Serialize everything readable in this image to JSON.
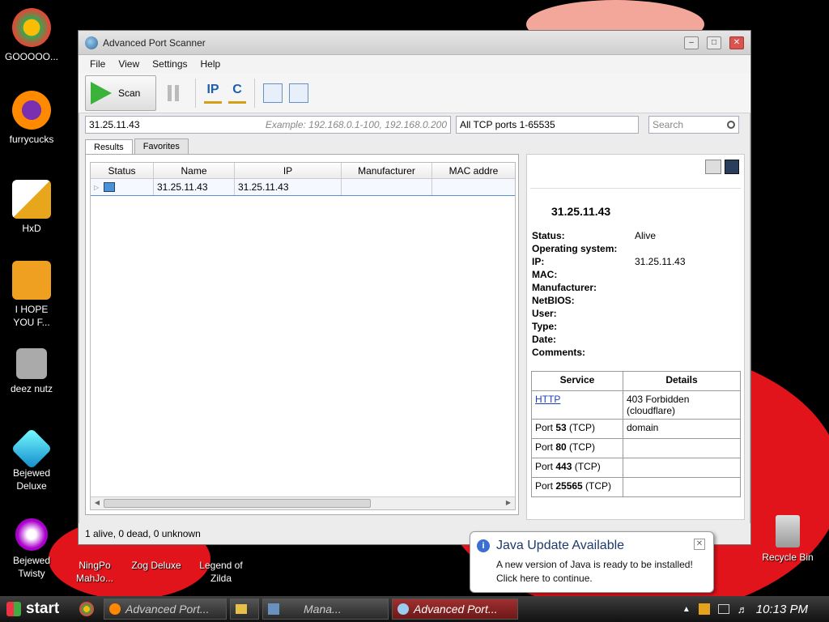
{
  "desktop": {
    "icons": [
      {
        "label": "GOOOOO..."
      },
      {
        "label": "furrycucks"
      },
      {
        "label": "HxD"
      },
      {
        "label": "I HOPE\nYOU F..."
      },
      {
        "label": "deez nutz"
      },
      {
        "label": "Bejewed\nDeluxe"
      },
      {
        "label": "Bejewed\nTwisty"
      },
      {
        "label": "NingPo\nMahJo..."
      },
      {
        "label": "Zog Deluxe"
      },
      {
        "label": "Legend of\nZilda"
      },
      {
        "label": "Recycle Bin"
      }
    ]
  },
  "window": {
    "title": "Advanced Port Scanner",
    "menu": [
      "File",
      "View",
      "Settings",
      "Help"
    ],
    "toolbar": {
      "scan_label": "Scan",
      "ip_icon": "IP",
      "c_icon": "C"
    },
    "ip_field": {
      "value": "31.25.11.43",
      "hint": "Example: 192.168.0.1-100, 192.168.0.200"
    },
    "ports_field": {
      "value": "All TCP ports 1-65535"
    },
    "search": {
      "placeholder": "Search"
    },
    "tabs": [
      "Results",
      "Favorites"
    ],
    "columns": [
      "Status",
      "Name",
      "IP",
      "Manufacturer",
      "MAC addre"
    ],
    "row": {
      "name": "31.25.11.43",
      "ip": "31.25.11.43"
    },
    "details": {
      "title": "31.25.11.43",
      "props": [
        {
          "k": "Status:",
          "v": "Alive"
        },
        {
          "k": "Operating system:",
          "v": ""
        },
        {
          "k": "IP:",
          "v": "31.25.11.43"
        },
        {
          "k": "MAC:",
          "v": ""
        },
        {
          "k": "Manufacturer:",
          "v": ""
        },
        {
          "k": "NetBIOS:",
          "v": ""
        },
        {
          "k": "User:",
          "v": ""
        },
        {
          "k": "Type:",
          "v": ""
        },
        {
          "k": "Date:",
          "v": ""
        },
        {
          "k": "Comments:",
          "v": ""
        }
      ],
      "services_header": [
        "Service",
        "Details"
      ],
      "services": [
        {
          "service": "HTTP",
          "link": true,
          "details": "403 Forbidden\n(cloudflare)"
        },
        {
          "pre": "Port ",
          "num": "53",
          "post": " (TCP)",
          "details": "domain"
        },
        {
          "pre": "Port ",
          "num": "80",
          "post": " (TCP)",
          "details": ""
        },
        {
          "pre": "Port ",
          "num": "443",
          "post": " (TCP)",
          "details": ""
        },
        {
          "pre": "Port ",
          "num": "25565",
          "post": " (TCP)",
          "details": ""
        }
      ]
    },
    "status_text": "1 alive, 0 dead, 0 unknown"
  },
  "balloon": {
    "title": "Java Update Available",
    "line1": "A new version of Java is ready to be installed!",
    "line2": "Click here to continue."
  },
  "taskbar": {
    "start": "start",
    "tasks": [
      "Advanced Port...",
      "Mana...",
      "Advanced Port..."
    ],
    "clock": "10:13 PM"
  }
}
